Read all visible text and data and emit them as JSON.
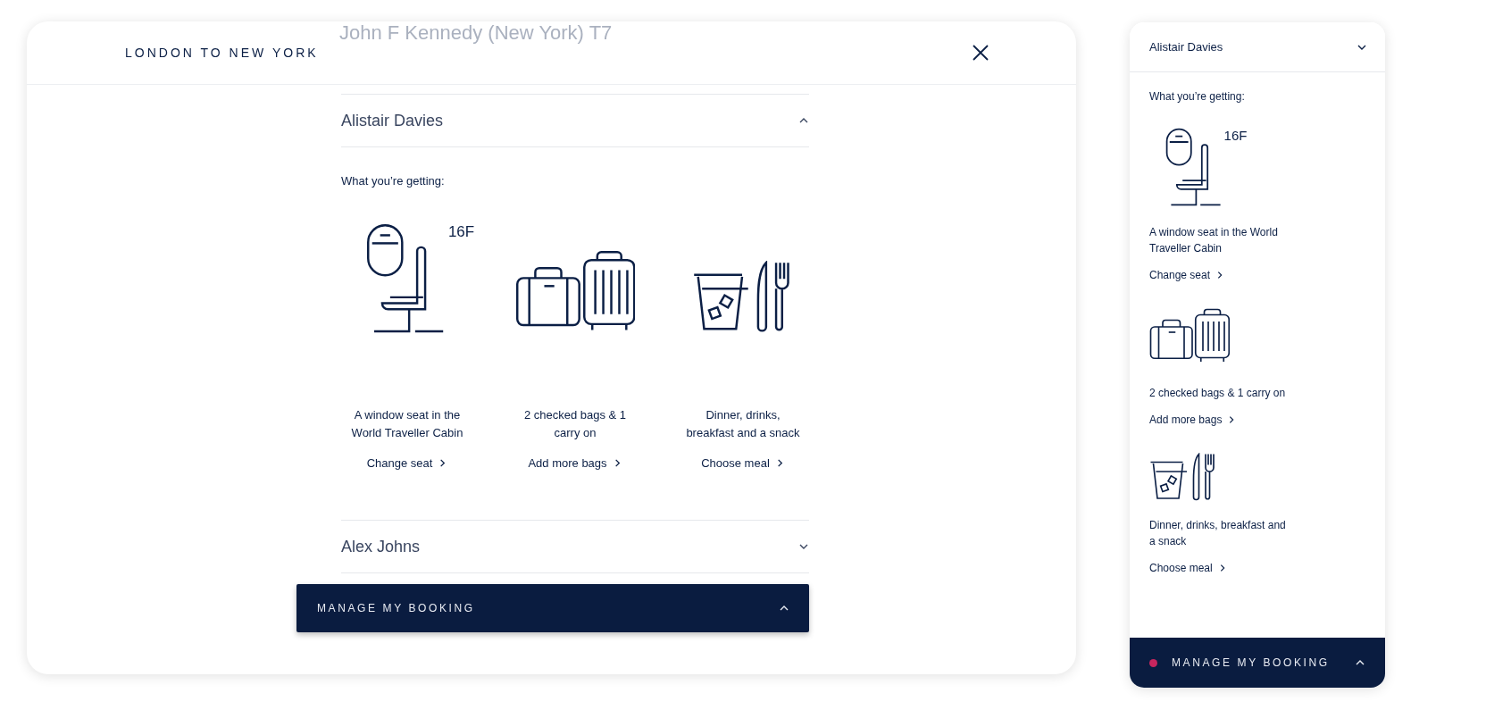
{
  "desktop": {
    "background_text": "John F Kennedy (New York) T7",
    "title": "LONDON TO NEW YORK",
    "passengers": [
      {
        "name": "Alistair Davies",
        "expanded": true,
        "intro": "What you’re getting:",
        "amenities": [
          {
            "kind": "seat",
            "seat": "16F",
            "caption": "A window seat in the World Traveller Cabin",
            "link": "Change seat"
          },
          {
            "kind": "bags",
            "caption": "2 checked bags & 1 carry on",
            "link": "Add more bags"
          },
          {
            "kind": "meal",
            "caption": "Dinner, drinks, breakfast and a snack",
            "link": "Choose meal"
          }
        ]
      },
      {
        "name": "Alex Johns",
        "expanded": false
      }
    ],
    "manage_bar": {
      "label": "MANAGE MY BOOKING",
      "notification": false
    }
  },
  "mobile": {
    "passenger": {
      "name": "Alistair Davies",
      "expanded": false,
      "intro": "What you’re getting:",
      "amenities": [
        {
          "kind": "seat",
          "seat": "16F",
          "caption": "A window seat in the World Traveller Cabin",
          "link": "Change seat"
        },
        {
          "kind": "bags",
          "caption": "2 checked bags & 1 carry on",
          "link": "Add more bags"
        },
        {
          "kind": "meal",
          "caption": "Dinner, drinks, breakfast and a snack",
          "link": "Choose meal"
        }
      ]
    },
    "manage_bar": {
      "label": "MANAGE MY BOOKING",
      "notification": true
    }
  }
}
